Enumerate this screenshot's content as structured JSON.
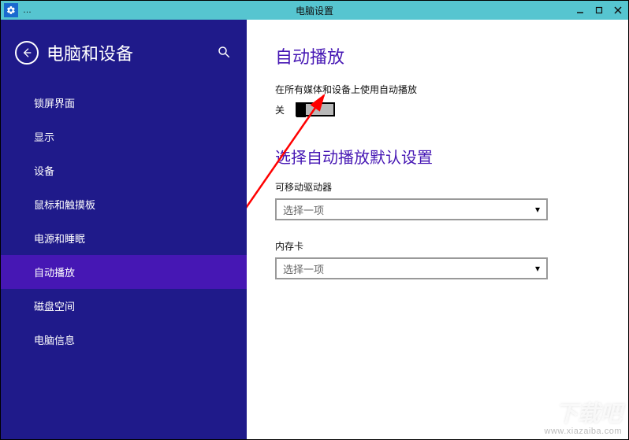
{
  "titlebar": {
    "app_token": "…",
    "title": "电脑设置"
  },
  "sidebar": {
    "title": "电脑和设备",
    "items": [
      {
        "label": "锁屏界面"
      },
      {
        "label": "显示"
      },
      {
        "label": "设备"
      },
      {
        "label": "鼠标和触摸板"
      },
      {
        "label": "电源和睡眠"
      },
      {
        "label": "自动播放"
      },
      {
        "label": "磁盘空间"
      },
      {
        "label": "电脑信息"
      }
    ],
    "active_index": 5
  },
  "content": {
    "heading1": "自动播放",
    "autoplay_desc": "在所有媒体和设备上使用自动播放",
    "toggle_state_label": "关",
    "heading2": "选择自动播放默认设置",
    "field1_label": "可移动驱动器",
    "field1_value": "选择一项",
    "field2_label": "内存卡",
    "field2_value": "选择一项"
  },
  "watermark": {
    "big": "下载吧",
    "small": "www.xiazaiba.com"
  }
}
